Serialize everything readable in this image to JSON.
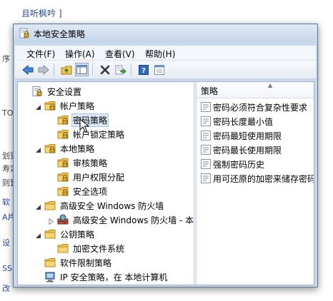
{
  "background": {
    "title": "且听枫吟 ]",
    "fragments": [
      "序",
      "TO",
      "划更",
      "寿定",
      "则置",
      "软",
      "A片",
      "设",
      "SS",
      "改"
    ]
  },
  "window": {
    "title": "本地安全策略"
  },
  "menu": [
    "文件(F)",
    "操作(A)",
    "查看(V)",
    "帮助(H)"
  ],
  "toolbar": {
    "icons": [
      "back-icon",
      "forward-icon",
      "up-folder-icon",
      "show-hide-tree-icon",
      "delete-icon",
      "export-list-icon",
      "help-icon",
      "properties-icon"
    ]
  },
  "tree": [
    {
      "label": "安全设置",
      "indent": 0,
      "icon": "security-settings-icon",
      "toggle": "none"
    },
    {
      "label": "帐户策略",
      "indent": 1,
      "icon": "folder-lock-icon",
      "toggle": "expanded"
    },
    {
      "label": "密码策略",
      "indent": 2,
      "icon": "folder-lock-icon",
      "toggle": "none",
      "selected": true
    },
    {
      "label": "帐户锁定策略",
      "indent": 2,
      "icon": "folder-lock-icon",
      "toggle": "none"
    },
    {
      "label": "本地策略",
      "indent": 1,
      "icon": "folder-lock-icon",
      "toggle": "expanded"
    },
    {
      "label": "审核策略",
      "indent": 2,
      "icon": "folder-lock-icon",
      "toggle": "none"
    },
    {
      "label": "用户权限分配",
      "indent": 2,
      "icon": "folder-lock-icon",
      "toggle": "none"
    },
    {
      "label": "安全选项",
      "indent": 2,
      "icon": "folder-lock-icon",
      "toggle": "none"
    },
    {
      "label": "高级安全 Windows 防火墙",
      "indent": 1,
      "icon": "folder-icon",
      "toggle": "expanded"
    },
    {
      "label": "高级安全 Windows 防火墙 - 本地",
      "indent": 2,
      "icon": "firewall-icon",
      "toggle": "collapsed"
    },
    {
      "label": "公钥策略",
      "indent": 1,
      "icon": "folder-icon",
      "toggle": "expanded"
    },
    {
      "label": "加密文件系统",
      "indent": 2,
      "icon": "folder-icon",
      "toggle": "none"
    },
    {
      "label": "软件限制策略",
      "indent": 1,
      "icon": "folder-icon",
      "toggle": "none"
    },
    {
      "label": "IP 安全策略，在 本地计算机",
      "indent": 1,
      "icon": "ip-security-icon",
      "toggle": "none"
    }
  ],
  "list": {
    "column": "策略",
    "items": [
      "密码必须符合复杂性要求",
      "密码长度最小值",
      "密码最短使用期限",
      "密码最长使用期限",
      "强制密码历史",
      "用可还原的加密来储存密码"
    ]
  },
  "colors": {
    "accent": "#2a47a8",
    "folder": "#f3c54e",
    "selection": "#dde8f7"
  }
}
